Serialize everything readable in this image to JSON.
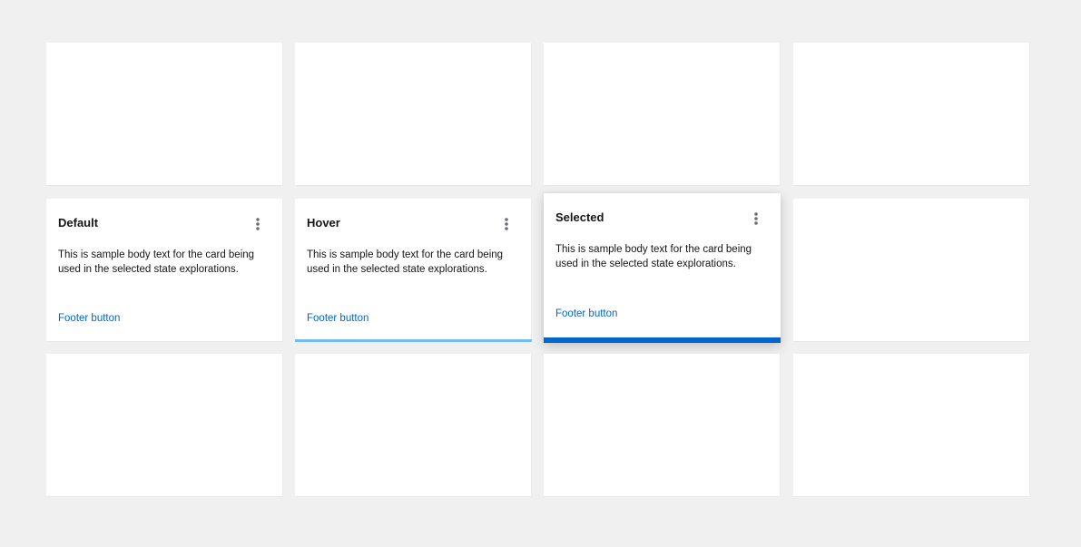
{
  "cards": {
    "default": {
      "title": "Default",
      "body": "This is sample body text for the card being used in the selected state explorations.",
      "footer": "Footer button"
    },
    "hover": {
      "title": "Hover",
      "body": "This is sample body text for the card being used in the selected state explorations.",
      "footer": "Footer button",
      "accent_color": "#73bcf7"
    },
    "selected": {
      "title": "Selected",
      "body": "This is sample body text for the card being used in the selected state explorations.",
      "footer": "Footer button",
      "accent_color": "#0066cc"
    }
  },
  "icons": {
    "menu": "kebab-vertical-icon"
  },
  "colors": {
    "background": "#f0f0f0",
    "card": "#ffffff",
    "link": "#0066cc"
  }
}
